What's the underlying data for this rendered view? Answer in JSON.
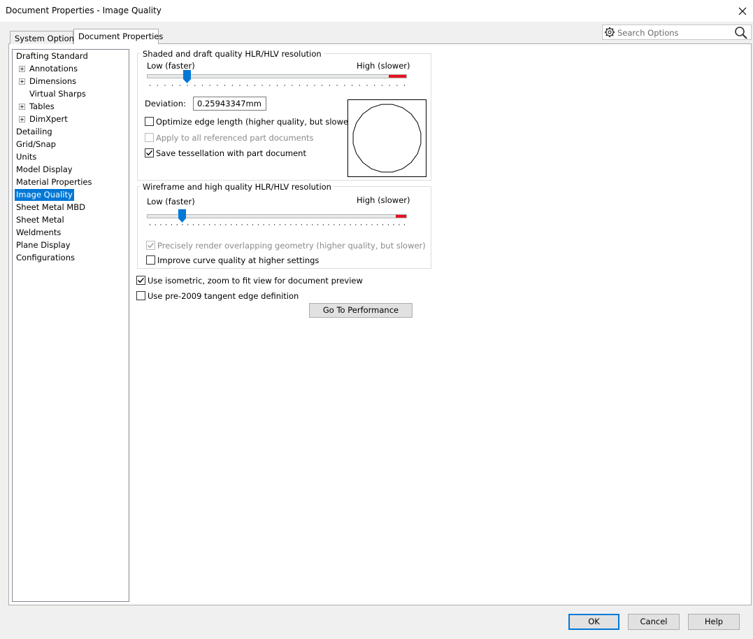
{
  "window": {
    "title": "Document Properties - Image Quality",
    "close_glyph": "✕"
  },
  "tabs": [
    {
      "label": "System Options",
      "active": false
    },
    {
      "label": "Document Properties",
      "active": true
    }
  ],
  "search": {
    "placeholder": "Search Options"
  },
  "tree": {
    "items": [
      {
        "label": "Drafting Standard",
        "level": 0,
        "expander": false,
        "selected": false
      },
      {
        "label": "Annotations",
        "level": 1,
        "expander": true,
        "selected": false
      },
      {
        "label": "Dimensions",
        "level": 1,
        "expander": true,
        "selected": false
      },
      {
        "label": "Virtual Sharps",
        "level": 1,
        "expander": false,
        "selected": false
      },
      {
        "label": "Tables",
        "level": 1,
        "expander": true,
        "selected": false
      },
      {
        "label": "DimXpert",
        "level": 1,
        "expander": true,
        "selected": false
      },
      {
        "label": "Detailing",
        "level": 0,
        "expander": false,
        "selected": false
      },
      {
        "label": "Grid/Snap",
        "level": 0,
        "expander": false,
        "selected": false
      },
      {
        "label": "Units",
        "level": 0,
        "expander": false,
        "selected": false
      },
      {
        "label": "Model Display",
        "level": 0,
        "expander": false,
        "selected": false
      },
      {
        "label": "Material Properties",
        "level": 0,
        "expander": false,
        "selected": false
      },
      {
        "label": "Image Quality",
        "level": 0,
        "expander": false,
        "selected": true
      },
      {
        "label": "Sheet Metal MBD",
        "level": 0,
        "expander": false,
        "selected": false
      },
      {
        "label": "Sheet Metal",
        "level": 0,
        "expander": false,
        "selected": false
      },
      {
        "label": "Weldments",
        "level": 0,
        "expander": false,
        "selected": false
      },
      {
        "label": "Plane Display",
        "level": 0,
        "expander": false,
        "selected": false
      },
      {
        "label": "Configurations",
        "level": 0,
        "expander": false,
        "selected": false
      }
    ]
  },
  "shaded": {
    "title": "Shaded and draft quality HLR/HLV resolution",
    "low_label": "Low (faster)",
    "high_label": "High (slower)",
    "slider_fraction": 0.14,
    "deviation_label": "Deviation:",
    "deviation_value": "0.25943347mm",
    "optimize_label": "Optimize edge length (higher quality, but slower)",
    "optimize_checked": false,
    "apply_label": "Apply to all referenced part documents",
    "apply_checked": false,
    "apply_disabled": true,
    "save_label": "Save tessellation with part document",
    "save_checked": true
  },
  "wireframe": {
    "title": "Wireframe and high quality HLR/HLV resolution",
    "low_label": "Low (faster)",
    "high_label": "High (slower)",
    "slider_fraction": 0.12,
    "precise_label": "Precisely render overlapping geometry (higher quality, but slower)",
    "precise_checked": true,
    "precise_disabled": true,
    "improve_label": "Improve curve quality at higher settings",
    "improve_checked": false
  },
  "options": {
    "isometric_label": "Use isometric, zoom to fit view for document preview",
    "isometric_checked": true,
    "pre2009_label": "Use pre-2009 tangent edge definition",
    "pre2009_checked": false,
    "performance_button": "Go To Performance"
  },
  "footer": {
    "ok": "OK",
    "cancel": "Cancel",
    "help": "Help"
  },
  "colors": {
    "accent": "#0078d7",
    "slider_red": "#e81123",
    "selection": "#0078d7"
  },
  "icons": {
    "search_gear": "gear-icon",
    "search_magnifier": "search-icon",
    "close": "close-icon"
  }
}
